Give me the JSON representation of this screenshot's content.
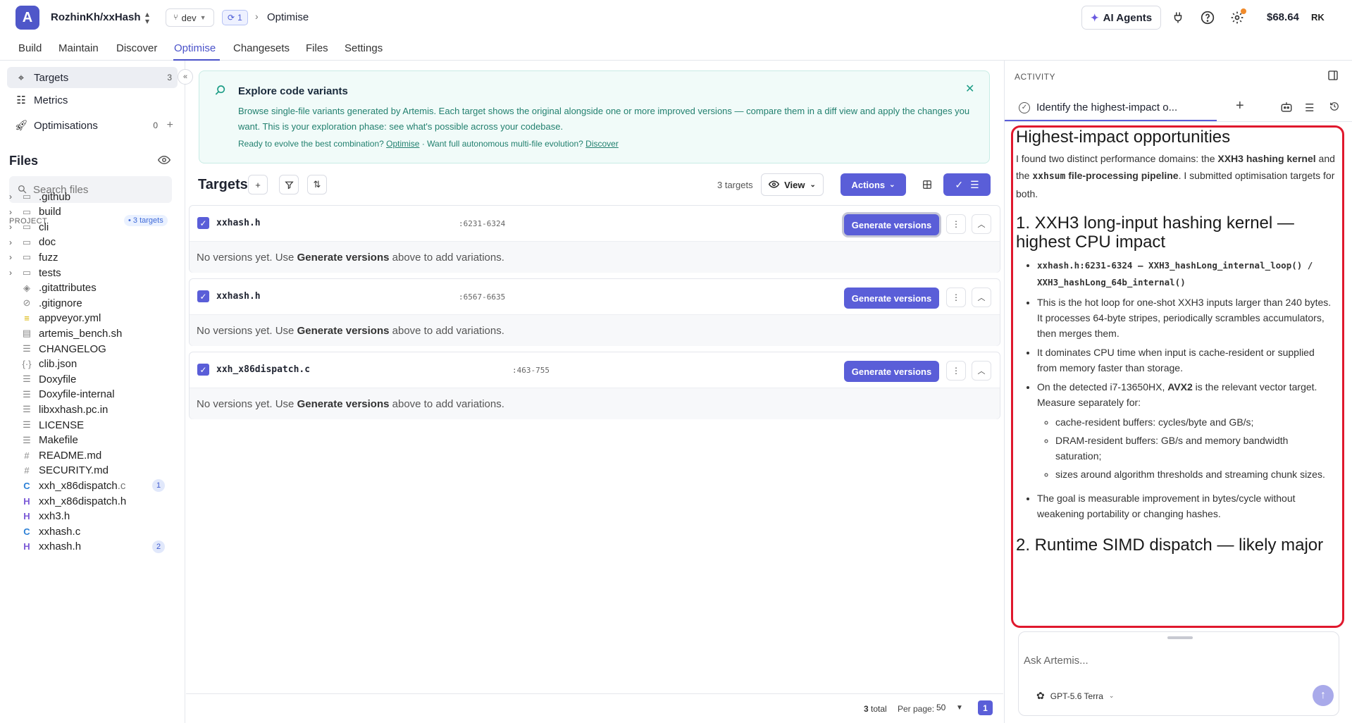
{
  "app": {
    "logo_letter": "A",
    "repo": "RozhinKh/xxHash",
    "branch": "dev",
    "sync_count": "1",
    "breadcrumb": "Optimise",
    "ai_agents_label": "AI Agents",
    "balance": "$68.64",
    "avatar_initials": "RK"
  },
  "nav": {
    "tabs": [
      "Build",
      "Maintain",
      "Discover",
      "Optimise",
      "Changesets",
      "Files",
      "Settings"
    ],
    "active": "Optimise"
  },
  "sidebar": {
    "items": [
      {
        "label": "Targets",
        "count": "3",
        "icon": "crosshair-icon"
      },
      {
        "label": "Metrics",
        "count": "",
        "icon": "bar-chart-icon"
      },
      {
        "label": "Optimisations",
        "count": "0",
        "icon": "rocket-icon"
      }
    ],
    "files_title": "Files",
    "search_placeholder": "Search files",
    "project_label": "PROJECT",
    "targets_pill": "• 3 targets",
    "tree": [
      {
        "name": ".github",
        "type": "folder"
      },
      {
        "name": "build",
        "type": "folder"
      },
      {
        "name": "cli",
        "type": "folder"
      },
      {
        "name": "doc",
        "type": "folder"
      },
      {
        "name": "fuzz",
        "type": "folder"
      },
      {
        "name": "tests",
        "type": "folder"
      },
      {
        "name": ".gitattributes",
        "type": "file",
        "icon": "◈"
      },
      {
        "name": ".gitignore",
        "type": "file",
        "icon": "⊘"
      },
      {
        "name": "appveyor.yml",
        "type": "yaml",
        "icon": "≡"
      },
      {
        "name": "artemis_bench.sh",
        "type": "file",
        "icon": "▤"
      },
      {
        "name": "CHANGELOG",
        "type": "file",
        "icon": "☰"
      },
      {
        "name": "clib.json",
        "type": "file",
        "icon": "{·}"
      },
      {
        "name": "Doxyfile",
        "type": "file",
        "icon": "☰"
      },
      {
        "name": "Doxyfile-internal",
        "type": "file",
        "icon": "☰"
      },
      {
        "name": "libxxhash.pc.in",
        "type": "file",
        "icon": "☰"
      },
      {
        "name": "LICENSE",
        "type": "file",
        "icon": "☰"
      },
      {
        "name": "Makefile",
        "type": "file",
        "icon": "☰"
      },
      {
        "name": "README.md",
        "type": "file",
        "icon": "#"
      },
      {
        "name": "SECURITY.md",
        "type": "file",
        "icon": "#"
      },
      {
        "name": "xxh_x86dispatch",
        "ext": ".c",
        "type": "c",
        "icon": "C",
        "badge": "1"
      },
      {
        "name": "xxh_x86dispatch.h",
        "type": "h",
        "icon": "H"
      },
      {
        "name": "xxh3.h",
        "type": "h",
        "icon": "H"
      },
      {
        "name": "xxhash.c",
        "type": "c",
        "icon": "C"
      },
      {
        "name": "xxhash.h",
        "type": "h",
        "icon": "H",
        "badge": "2"
      }
    ]
  },
  "banner": {
    "title": "Explore code variants",
    "text": "Browse single-file variants generated by Artemis. Each target shows the original alongside one or more improved versions — compare them in a diff view and apply the changes you want. This is your exploration phase: see what's possible across your codebase.",
    "foot_prefix": "Ready to evolve the best combination?",
    "optimise_link": "Optimise",
    "foot_middle": "· Want full autonomous multi-file evolution?",
    "discover_link": "Discover"
  },
  "targets": {
    "title": "Targets",
    "count_text": "3 targets",
    "view_label": "View",
    "actions_label": "Actions",
    "generate_label": "Generate versions",
    "empty_prefix": "No versions yet. Use",
    "empty_bold": "Generate versions",
    "empty_suffix": "above to add variations.",
    "items": [
      {
        "file": "xxhash.h",
        "range": ":6231-6324"
      },
      {
        "file": "xxhash.h",
        "range": ":6567-6635"
      },
      {
        "file": "xxh_x86dispatch.c",
        "range": ":463-755"
      }
    ]
  },
  "pagination": {
    "total": "3",
    "total_label": "total",
    "per_page_label": "Per page:",
    "per_page": "50",
    "page": "1"
  },
  "activity": {
    "title": "ACTIVITY",
    "chat_tab": "Identify the highest-impact o...",
    "message": {
      "heading": "Highest-impact opportunities",
      "intro_1": "I found two distinct performance domains: the",
      "intro_b1": "XXH3 hashing kernel",
      "intro_2": "and the",
      "intro_code": "xxhsum",
      "intro_b2": "file-processing pipeline",
      "intro_3": ". I submitted optimisation targets for both.",
      "section1": "1. XXH3 long-input hashing kernel — highest CPU impact",
      "bullet_code": "xxhash.h:6231-6324 — XXH3_hashLong_internal_loop() / XXH3_hashLong_64b_internal()",
      "bullet_2": "This is the hot loop for one-shot XXH3 inputs larger than 240 bytes. It processes 64-byte stripes, periodically scrambles accumulators, then merges them.",
      "bullet_3": "It dominates CPU time when input is cache-resident or supplied from memory faster than storage.",
      "bullet_4a": "On the detected i7-13650HX,",
      "bullet_4b": "AVX2",
      "bullet_4c": "is the relevant vector target. Measure separately for:",
      "sub_1": "cache-resident buffers: cycles/byte and GB/s;",
      "sub_2": "DRAM-resident buffers: GB/s and memory bandwidth saturation;",
      "sub_3": "sizes around algorithm thresholds and streaming chunk sizes.",
      "bullet_5": "The goal is measurable improvement in bytes/cycle without weakening portability or changing hashes.",
      "section2": "2. Runtime SIMD dispatch — likely major"
    },
    "ask_placeholder": "Ask Artemis...",
    "model": "GPT-5.6 Terra"
  },
  "colors": {
    "accent": "#5a5ed8",
    "banner_bg": "#f1fbf9",
    "highlight_border": "#e0182d"
  }
}
